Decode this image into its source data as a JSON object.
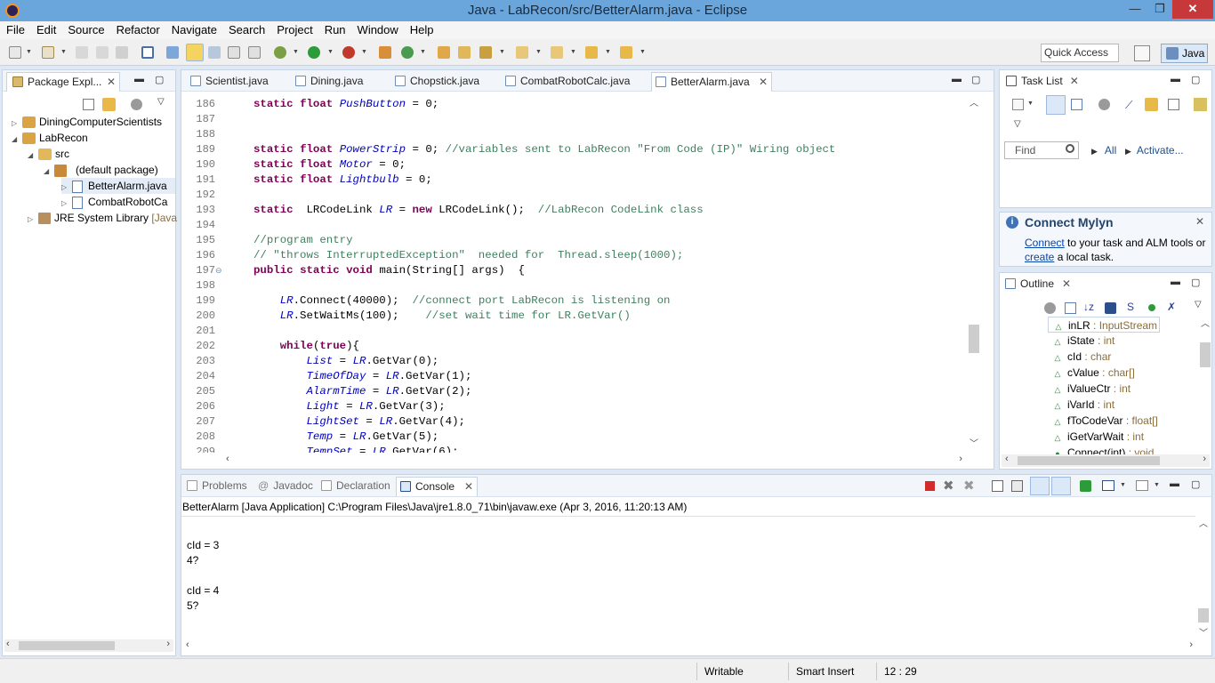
{
  "window": {
    "title": "Java - LabRecon/src/BetterAlarm.java - Eclipse",
    "minimize_glyph": "—",
    "maximize_glyph": "❐",
    "close_glyph": "✕"
  },
  "menu": [
    "File",
    "Edit",
    "Source",
    "Refactor",
    "Navigate",
    "Search",
    "Project",
    "Run",
    "Window",
    "Help"
  ],
  "toolbar": {
    "quick_access": "Quick Access",
    "perspective": "Java"
  },
  "package_explorer": {
    "tab_label": "Package Expl...",
    "items": [
      {
        "label": "DiningComputerScientists",
        "extra": ""
      },
      {
        "label": "LabRecon",
        "extra": ""
      },
      {
        "label": "src",
        "extra": ""
      },
      {
        "label": "(default package)",
        "extra": ""
      },
      {
        "label": "BetterAlarm.java",
        "extra": ""
      },
      {
        "label": "CombatRobotCa",
        "extra": ""
      },
      {
        "label": "JRE System Library",
        "extra": "[Java"
      }
    ]
  },
  "editor": {
    "tabs": [
      "Scientist.java",
      "Dining.java",
      "Chopstick.java",
      "CombatRobotCalc.java",
      "BetterAlarm.java"
    ],
    "active_tab": "BetterAlarm.java",
    "line_numbers": [
      "186",
      "187",
      "188",
      "189",
      "190",
      "191",
      "192",
      "193",
      "194",
      "195",
      "196",
      "197",
      "198",
      "199",
      "200",
      "201",
      "202",
      "203",
      "204",
      "205",
      "206",
      "207",
      "208",
      "209"
    ],
    "lines": [
      [
        [
          "kw",
          "static "
        ],
        [
          "kw",
          "float "
        ],
        [
          "fi",
          "PushButton"
        ],
        [
          "t",
          " = 0;"
        ]
      ],
      [],
      [],
      [
        [
          "kw",
          "static "
        ],
        [
          "kw",
          "float "
        ],
        [
          "fi",
          "PowerStrip"
        ],
        [
          "t",
          " = 0; "
        ],
        [
          "cm",
          "//variables sent to LabRecon \"From Code (IP)\" Wiring object"
        ]
      ],
      [
        [
          "kw",
          "static "
        ],
        [
          "kw",
          "float "
        ],
        [
          "fi",
          "Motor"
        ],
        [
          "t",
          " = 0;"
        ]
      ],
      [
        [
          "kw",
          "static "
        ],
        [
          "kw",
          "float "
        ],
        [
          "fi",
          "Lightbulb"
        ],
        [
          "t",
          " = 0;"
        ]
      ],
      [],
      [
        [
          "kw",
          "static "
        ],
        [
          "t",
          " LRCodeLink "
        ],
        [
          "fi",
          "LR"
        ],
        [
          "t",
          " = "
        ],
        [
          "kw",
          "new "
        ],
        [
          "t",
          "LRCodeLink();  "
        ],
        [
          "cm",
          "//LabRecon CodeLink class"
        ]
      ],
      [],
      [
        [
          "cm",
          "//program entry"
        ]
      ],
      [
        [
          "cm",
          "// \"throws InterruptedException\"  needed for  Thread.sleep(1000);"
        ]
      ],
      [
        [
          "kw",
          "public "
        ],
        [
          "kw",
          "static "
        ],
        [
          "kw",
          "void "
        ],
        [
          "t",
          "main(String[] args)  {"
        ]
      ],
      [],
      [
        [
          "t",
          "    "
        ],
        [
          "fi",
          "LR"
        ],
        [
          "t",
          ".Connect(40000);  "
        ],
        [
          "cm",
          "//connect port LabRecon is listening on"
        ]
      ],
      [
        [
          "t",
          "    "
        ],
        [
          "fi",
          "LR"
        ],
        [
          "t",
          ".SetWaitMs(100);    "
        ],
        [
          "cm",
          "//set wait time for LR.GetVar()"
        ]
      ],
      [],
      [
        [
          "t",
          "    "
        ],
        [
          "kw",
          "while"
        ],
        [
          "t",
          "("
        ],
        [
          "kw",
          "true"
        ],
        [
          "t",
          "){"
        ]
      ],
      [
        [
          "t",
          "        "
        ],
        [
          "fi",
          "List"
        ],
        [
          "t",
          " = "
        ],
        [
          "fi",
          "LR"
        ],
        [
          "t",
          ".GetVar(0);"
        ]
      ],
      [
        [
          "t",
          "        "
        ],
        [
          "fi",
          "TimeOfDay"
        ],
        [
          "t",
          " = "
        ],
        [
          "fi",
          "LR"
        ],
        [
          "t",
          ".GetVar(1);"
        ]
      ],
      [
        [
          "t",
          "        "
        ],
        [
          "fi",
          "AlarmTime"
        ],
        [
          "t",
          " = "
        ],
        [
          "fi",
          "LR"
        ],
        [
          "t",
          ".GetVar(2);"
        ]
      ],
      [
        [
          "t",
          "        "
        ],
        [
          "fi",
          "Light"
        ],
        [
          "t",
          " = "
        ],
        [
          "fi",
          "LR"
        ],
        [
          "t",
          ".GetVar(3);"
        ]
      ],
      [
        [
          "t",
          "        "
        ],
        [
          "fi",
          "LightSet"
        ],
        [
          "t",
          " = "
        ],
        [
          "fi",
          "LR"
        ],
        [
          "t",
          ".GetVar(4);"
        ]
      ],
      [
        [
          "t",
          "        "
        ],
        [
          "fi",
          "Temp"
        ],
        [
          "t",
          " = "
        ],
        [
          "fi",
          "LR"
        ],
        [
          "t",
          ".GetVar(5);"
        ]
      ],
      [
        [
          "t",
          "        "
        ],
        [
          "fi",
          "TempSet"
        ],
        [
          "t",
          " = "
        ],
        [
          "fi",
          "LR"
        ],
        [
          "t",
          ".GetVar(6);"
        ]
      ]
    ]
  },
  "task_list": {
    "tab_label": "Task List",
    "find_placeholder": "Find",
    "all_label": "All",
    "activate_label": "Activate..."
  },
  "connect_mylyn": {
    "title": "Connect Mylyn",
    "connect_link": "Connect",
    "text1": " to your task and ALM tools or",
    "create_link": "create",
    "text2": " a local task."
  },
  "outline": {
    "tab_label": "Outline",
    "items": [
      {
        "name": "inLR",
        "type": " : InputStream"
      },
      {
        "name": "iState",
        "type": " : int"
      },
      {
        "name": "cId",
        "type": " : char"
      },
      {
        "name": "cValue",
        "type": " : char[]"
      },
      {
        "name": "iValueCtr",
        "type": " : int"
      },
      {
        "name": "iVarId",
        "type": " : int"
      },
      {
        "name": "fToCodeVar",
        "type": " : float[]"
      },
      {
        "name": "iGetVarWait",
        "type": " : int"
      },
      {
        "name": "Connect(int)",
        "type": " : void"
      }
    ]
  },
  "bottom_panel": {
    "tabs": [
      "Problems",
      "Javadoc",
      "Declaration",
      "Console"
    ],
    "active_tab": "Console",
    "console_header": "BetterAlarm [Java Application] C:\\Program Files\\Java\\jre1.8.0_71\\bin\\javaw.exe (Apr 3, 2016, 11:20:13 AM)",
    "console_lines": [
      "",
      "cId = 3",
      "4?",
      "",
      "cId = 4",
      "5?"
    ]
  },
  "status_bar": {
    "writable": "Writable",
    "insert_mode": "Smart Insert",
    "position": "12 : 29"
  }
}
